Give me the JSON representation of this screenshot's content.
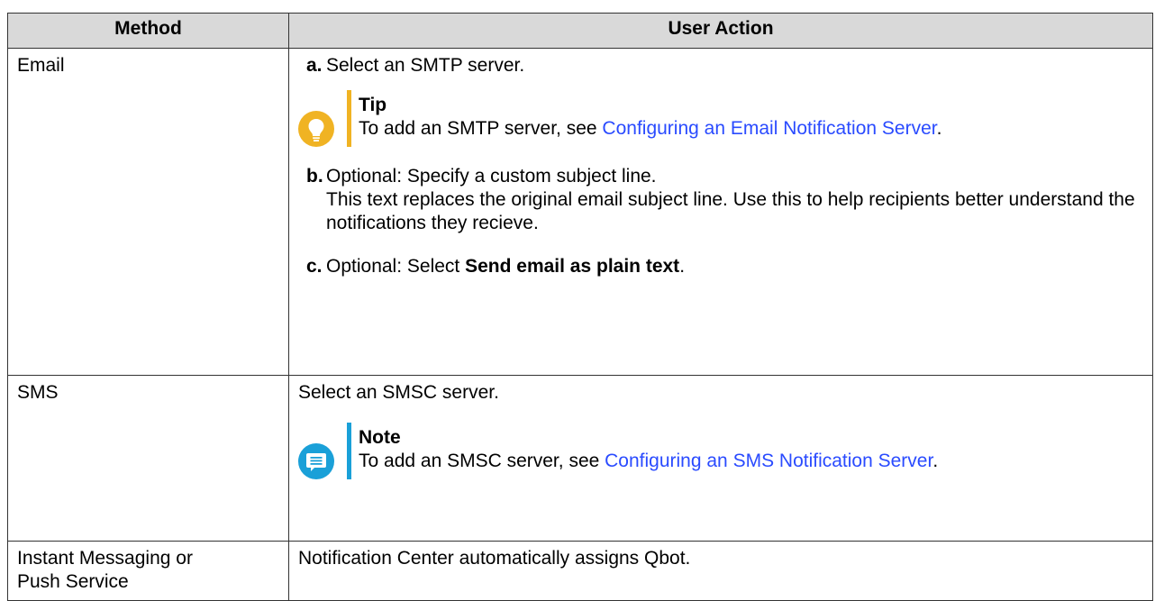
{
  "table": {
    "headers": {
      "method": "Method",
      "action": "User Action"
    },
    "rows": {
      "email": {
        "method": "Email",
        "step_a": {
          "letter": "a.",
          "text": "Select an SMTP server."
        },
        "tip": {
          "title": "Tip",
          "text_before": "To add an SMTP server, see ",
          "link_text": "Configuring an Email Notification Server",
          "text_after": ".",
          "icon": "lightbulb-icon",
          "accent_color": "#f0b323"
        },
        "step_b": {
          "letter": "b.",
          "text": "Optional: Specify a custom subject line.",
          "description": "This text replaces the original email subject line. Use this to help recipients better understand the notifications they recieve."
        },
        "step_c": {
          "letter": "c.",
          "text_before": "Optional: Select ",
          "bold_text": "Send email as plain text",
          "text_after": "."
        }
      },
      "sms": {
        "method": "SMS",
        "action": "Select an SMSC server.",
        "note": {
          "title": "Note",
          "text_before": "To add an SMSC server, see ",
          "link_text": "Configuring an SMS Notification Server",
          "text_after": ".",
          "icon": "note-icon",
          "accent_color": "#1aa0d8"
        }
      },
      "im": {
        "method": "Instant Messaging or Push Service",
        "action": "Notification Center automatically assigns Qbot."
      }
    }
  },
  "colors": {
    "header_bg": "#d9d9d9",
    "link": "#2a4bff",
    "border": "#333333"
  }
}
